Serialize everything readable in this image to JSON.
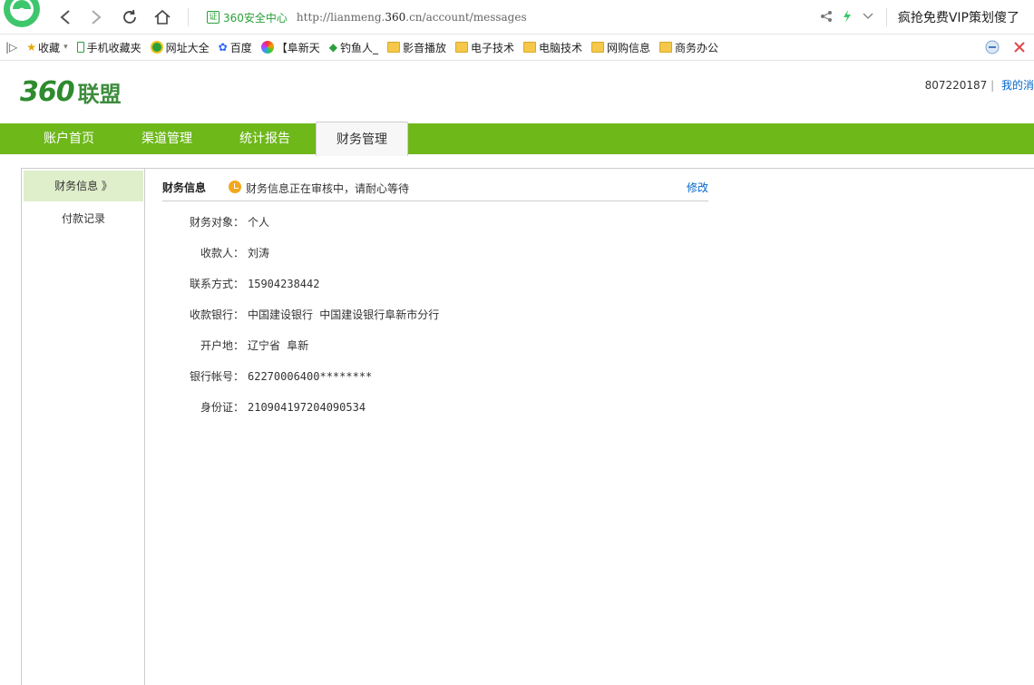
{
  "browser": {
    "logo_icon": "360-browser-icon",
    "cert_badge": "证",
    "security_label": "360安全中心",
    "url_prefix": "http://lianmeng.",
    "url_domain": "360",
    "url_middle": ".cn",
    "url_suffix": "/account/messages",
    "promo_text": "疯抢免费VIP策划傻了"
  },
  "bookmarks": [
    {
      "label": "收藏",
      "icon": "star-icon"
    },
    {
      "label": "手机收藏夹",
      "icon": "phone-icon"
    },
    {
      "label": "网址大全",
      "icon": "site-icon"
    },
    {
      "label": "百度",
      "icon": "baidu-icon"
    },
    {
      "label": "【阜新天",
      "icon": "colorful-icon"
    },
    {
      "label": "钓鱼人_",
      "icon": "fish-icon"
    },
    {
      "label": "影音播放",
      "icon": "folder-icon"
    },
    {
      "label": "电子技术",
      "icon": "folder-icon"
    },
    {
      "label": "电脑技术",
      "icon": "folder-icon"
    },
    {
      "label": "网购信息",
      "icon": "folder-icon"
    },
    {
      "label": "商务办公",
      "icon": "folder-icon"
    }
  ],
  "site": {
    "logo_num": "360",
    "logo_cn": "联盟",
    "account_id": "807220187",
    "account_link": "我的消"
  },
  "nav": {
    "tabs": [
      "账户首页",
      "渠道管理",
      "统计报告",
      "财务管理"
    ]
  },
  "sidebar": {
    "items": [
      "财务信息 》",
      "付款记录"
    ]
  },
  "panel": {
    "title": "财务信息",
    "status": "财务信息正在审核中，请耐心等待",
    "edit": "修改"
  },
  "finance": [
    {
      "label": "财务对象：",
      "value": "个人"
    },
    {
      "label": "收款人：",
      "value": "刘涛"
    },
    {
      "label": "联系方式：",
      "value": "15904238442"
    },
    {
      "label": "收款银行：",
      "value": "中国建设银行 中国建设银行阜新市分行"
    },
    {
      "label": "开户地：",
      "value": "辽宁省 阜新"
    },
    {
      "label": "银行帐号：",
      "value": "62270006400********"
    },
    {
      "label": "身份证：",
      "value": "210904197204090534"
    }
  ]
}
